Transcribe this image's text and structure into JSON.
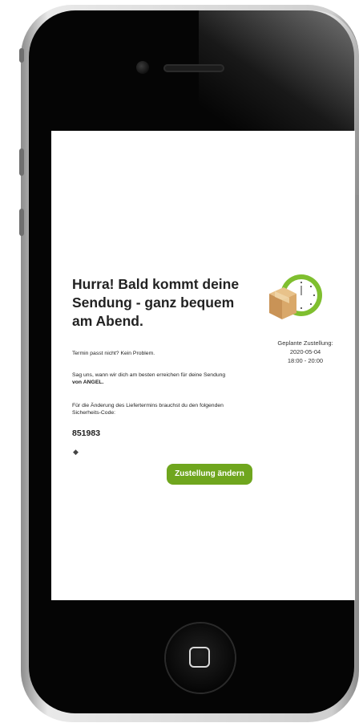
{
  "headline": "Hurra! Bald kommt deine Sendung - ganz bequem am Abend.",
  "paragraph_1": "Termin passt nicht? Kein Problem.",
  "paragraph_2_part1": "Sag uns, wann wir dich am besten erreichen für deine Sendung",
  "paragraph_2_part2": "von ANGEL.",
  "paragraph_3_part1": "Für die Änderung des Liefertermins brauchst du den folgenden",
  "paragraph_3_part2": "Sicherheits-Code:",
  "security_code": "851983",
  "bullet": "◆",
  "cta_label": "Zustellung ändern",
  "planned": {
    "label": "Geplante Zustellung:",
    "date": "2020-05-04",
    "time": "18:00 - 20:00"
  },
  "colors": {
    "accent": "#6fa61e",
    "phone_body": "#050505",
    "screen": "#ffffff"
  },
  "icons": [
    "clock-icon",
    "package-icon",
    "home-button-square-icon",
    "camera-icon",
    "speaker-icon"
  ]
}
